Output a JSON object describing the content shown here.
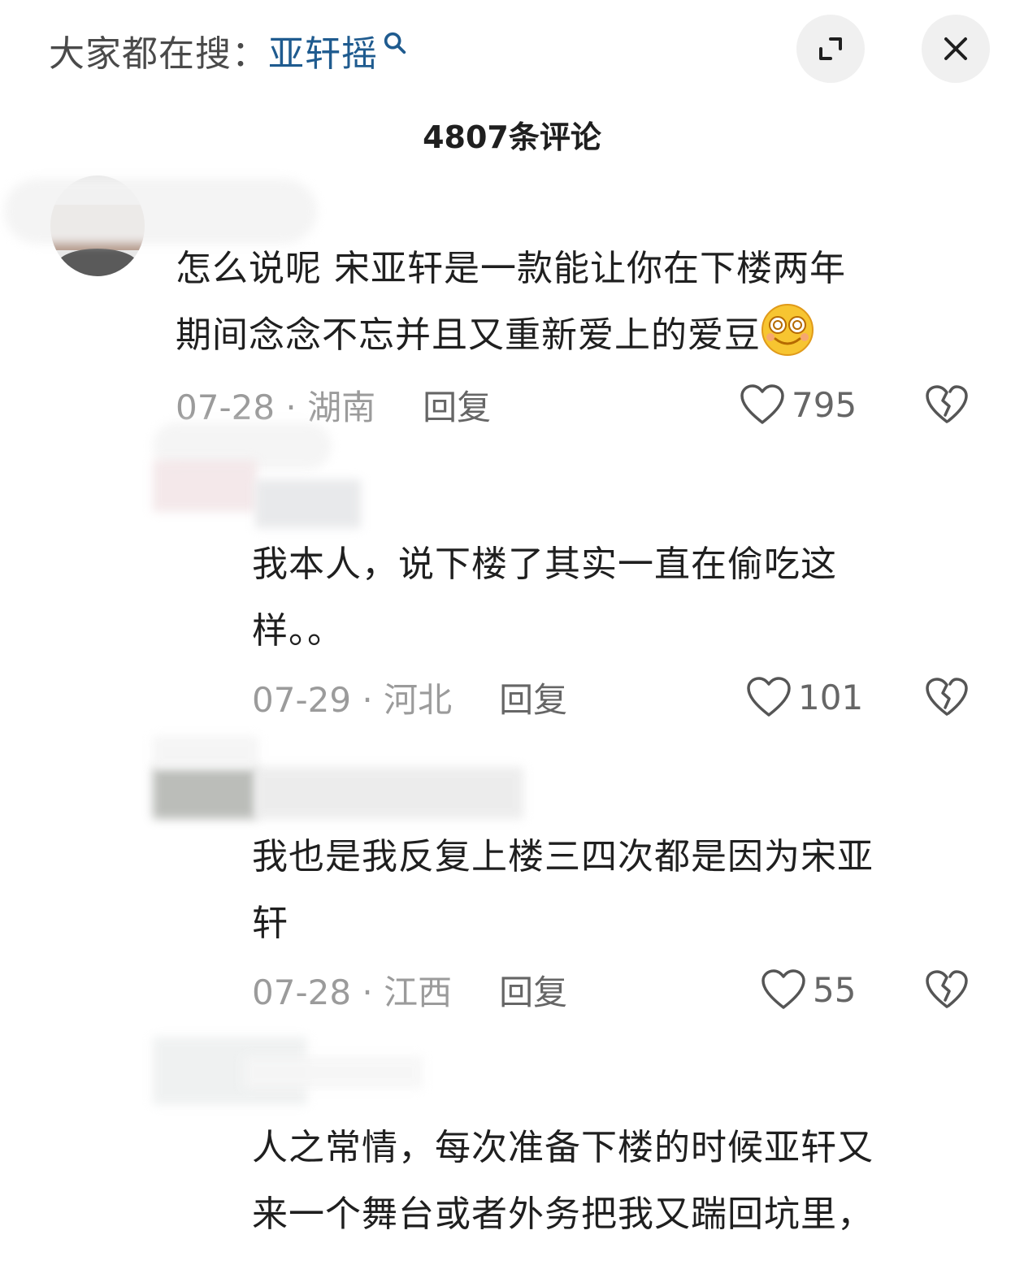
{
  "header": {
    "search_prefix": "大家都在搜：",
    "search_term": "亚轩摇",
    "search_icon": "search-icon",
    "expand_icon": "expand-icon",
    "close_icon": "close-icon",
    "comment_count": "4807条评论"
  },
  "comments": [
    {
      "text_line1": "怎么说呢 宋亚轩是一款能让你在下楼两年",
      "text_line2": "期间念念不忘并且又重新爱上的爱豆",
      "emoji": "smiling-face-emoji",
      "date_location": "07-28 · 湖南",
      "reply": "回复",
      "likes": "795"
    },
    {
      "text_line1": "我本人，说下楼了其实一直在偷吃这",
      "text_line2": "样。。",
      "date_location": "07-29 · 河北",
      "reply": "回复",
      "likes": "101"
    },
    {
      "text_line1": "我也是我反复上楼三四次都是因为宋亚",
      "text_line2": "轩",
      "date_location": "07-28 · 江西",
      "reply": "回复",
      "likes": "55"
    },
    {
      "text_line1": "人之常情，每次准备下楼的时候亚轩又",
      "text_line2": "来一个舞台或者外务把我又踹回坑里，"
    }
  ],
  "colors": {
    "link": "#1f5b8f",
    "meta": "#9b9b9b",
    "text": "#1f1f1f",
    "button_bg": "#f0f0f0"
  }
}
